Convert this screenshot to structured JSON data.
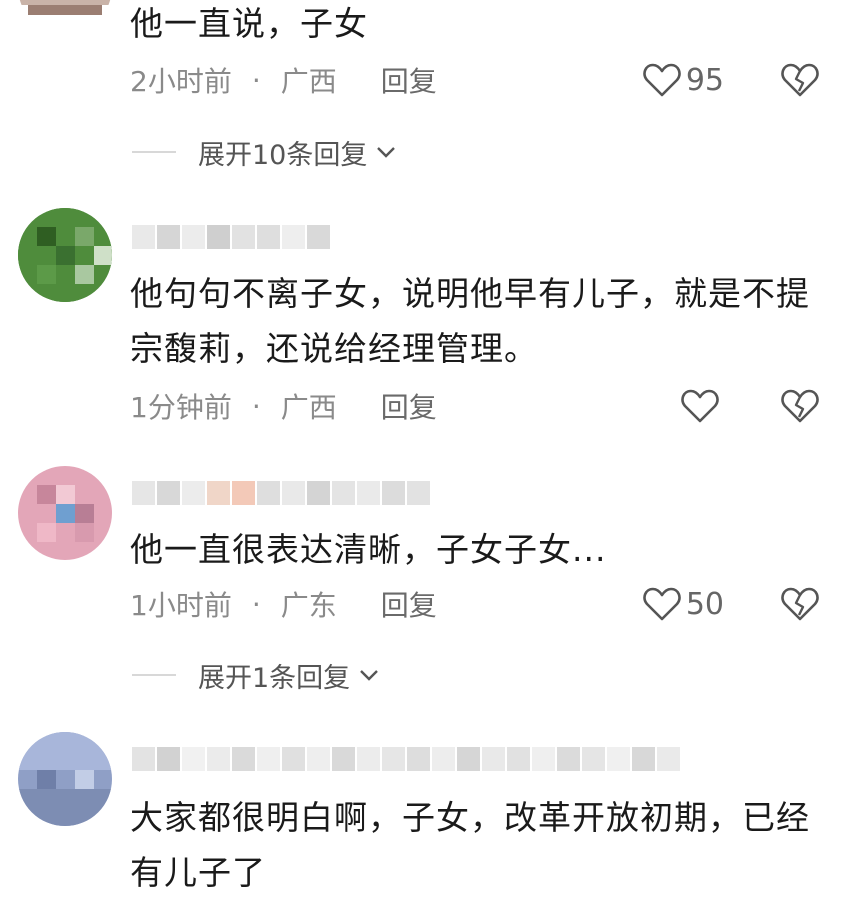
{
  "comments": [
    {
      "text": "他一直说，子女",
      "time": "2小时前",
      "location": "广西",
      "reply_label": "回复",
      "likes": "95",
      "expand_label": "展开10条回复"
    },
    {
      "text": "他句句不离子女，说明他早有儿子，就是不提宗馥莉，还说给经理管理。",
      "time": "1分钟前",
      "location": "广西",
      "reply_label": "回复",
      "likes": ""
    },
    {
      "text": "他一直很表达清晰，子女子女...",
      "time": "1小时前",
      "location": "广东",
      "reply_label": "回复",
      "likes": "50",
      "expand_label": "展开1条回复"
    },
    {
      "text": "大家都很明白啊，子女，改革开放初期，已经有儿子了"
    }
  ],
  "separator": "·",
  "colors": {
    "meta_text": "#8a8a8a",
    "icon": "#555555",
    "avatar2": "#3f7a2e",
    "avatar3": "#e3a6b8",
    "avatar4": "#8f9fc6"
  },
  "icons": {
    "like": "heart-outline-icon",
    "dislike": "broken-heart-icon",
    "expand": "chevron-down-icon"
  }
}
